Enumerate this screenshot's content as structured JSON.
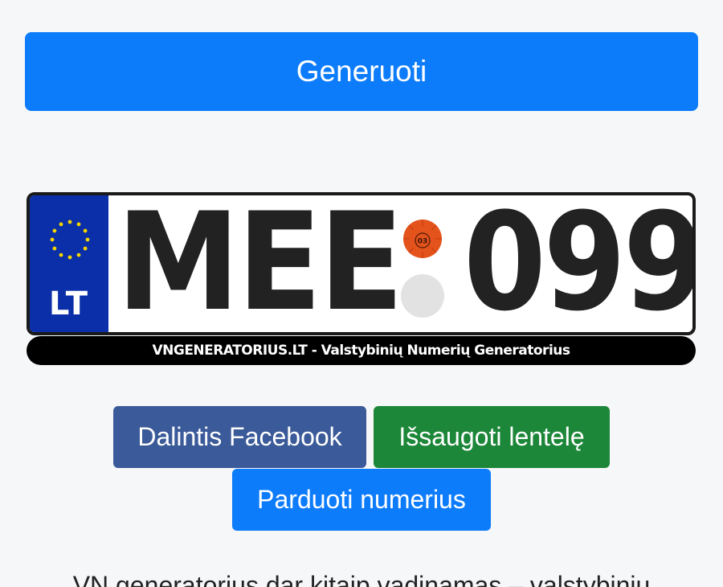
{
  "generate": {
    "label": "Generuoti"
  },
  "plate": {
    "country_code": "LT",
    "letters": "MEE",
    "digits": "099",
    "sticker_number": "03",
    "banner": "VNGENERATORIUS.LT - Valstybinių Numerių Generatorius"
  },
  "actions": {
    "facebook_label": "Dalintis Facebook",
    "save_label": "Išsaugoti lentelę",
    "sell_label": "Parduoti numerius"
  },
  "intro": {
    "text": "VN generatorius dar kitaip vadinamas – valstybinių"
  },
  "colors": {
    "primary": "#0d7cfb",
    "facebook": "#3b5a99",
    "success": "#1d8739",
    "eu_blue": "#0b2fa8",
    "eu_star": "#f5d400",
    "sticker": "#e4531b"
  }
}
